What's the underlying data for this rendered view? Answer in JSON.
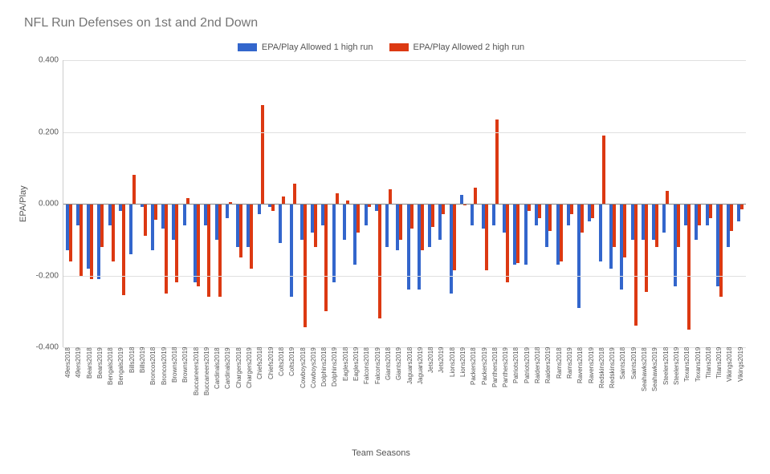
{
  "chart_data": {
    "type": "bar",
    "title": "NFL Run Defenses on 1st and 2nd Down",
    "xlabel": "Team Seasons",
    "ylabel": "EPA/Play",
    "ylim": [
      -0.4,
      0.4
    ],
    "yticks": [
      -0.4,
      -0.2,
      0.0,
      0.2,
      0.4
    ],
    "legend_position": "top-center",
    "categories": [
      "49ers2018",
      "49ers2019",
      "Bears2018",
      "Bears2019",
      "Bengals2018",
      "Bengals2019",
      "Bills2018",
      "Bills2019",
      "Broncos2018",
      "Broncos2019",
      "Browns2018",
      "Browns2019",
      "Buccaneers2018",
      "Buccaneers2019",
      "Cardinals2018",
      "Cardinals2019",
      "Chargers2018",
      "Chargers2019",
      "Chiefs2018",
      "Chiefs2019",
      "Colts2018",
      "Colts2019",
      "Cowboys2018",
      "Cowboys2019",
      "Dolphins2018",
      "Dolphins2019",
      "Eagles2018",
      "Eagles2019",
      "Falcons2018",
      "Falcons2019",
      "Giants2018",
      "Giants2019",
      "Jaguars2018",
      "Jaguars2019",
      "Jets2018",
      "Jets2019",
      "Lions2018",
      "Lions2019",
      "Packers2018",
      "Packers2019",
      "Panthers2018",
      "Panthers2019",
      "Patriots2018",
      "Patriots2019",
      "Raiders2018",
      "Raiders2019",
      "Rams2018",
      "Rams2019",
      "Ravens2018",
      "Ravens2019",
      "Redskins2018",
      "Redskins2019",
      "Saints2018",
      "Saints2019",
      "Seahawks2018",
      "Seahawks2019",
      "Steelers2018",
      "Steelers2019",
      "Texans2018",
      "Texans2019",
      "Titans2018",
      "Titans2019",
      "Vikings2018",
      "Vikings2019"
    ],
    "series": [
      {
        "name": "EPA/Play Allowed 1 high run",
        "color": "#3366cc",
        "values": [
          -0.13,
          -0.06,
          -0.18,
          -0.21,
          -0.06,
          -0.02,
          -0.14,
          -0.01,
          -0.13,
          -0.07,
          -0.1,
          -0.06,
          -0.22,
          -0.06,
          -0.1,
          -0.04,
          -0.12,
          -0.12,
          -0.03,
          -0.01,
          -0.11,
          -0.26,
          -0.1,
          -0.08,
          -0.06,
          -0.22,
          -0.1,
          -0.17,
          -0.06,
          -0.02,
          -0.12,
          -0.13,
          -0.24,
          -0.24,
          -0.12,
          -0.1,
          -0.25,
          0.025,
          -0.06,
          -0.07,
          -0.06,
          -0.08,
          -0.17,
          -0.17,
          -0.06,
          -0.12,
          -0.17,
          -0.06,
          -0.29,
          -0.05,
          -0.16,
          -0.18,
          -0.24,
          -0.1,
          -0.1,
          -0.1,
          -0.08,
          -0.23,
          -0.06,
          -0.1,
          -0.06,
          -0.23,
          -0.12,
          -0.05
        ]
      },
      {
        "name": "EPA/Play Allowed 2 high run",
        "color": "#dc3912",
        "values": [
          -0.16,
          -0.2,
          -0.21,
          -0.12,
          -0.16,
          -0.255,
          0.08,
          -0.09,
          -0.045,
          -0.25,
          -0.22,
          0.015,
          -0.23,
          -0.26,
          -0.26,
          0.005,
          -0.15,
          -0.18,
          0.275,
          -0.02,
          0.02,
          0.055,
          -0.345,
          -0.12,
          -0.3,
          0.03,
          0.01,
          -0.08,
          -0.01,
          -0.32,
          0.04,
          -0.1,
          -0.07,
          -0.13,
          -0.065,
          -0.03,
          -0.185,
          -0.005,
          0.045,
          -0.185,
          0.235,
          -0.22,
          -0.165,
          -0.02,
          -0.04,
          -0.075,
          -0.16,
          -0.03,
          -0.08,
          -0.04,
          0.19,
          -0.12,
          -0.15,
          -0.34,
          -0.245,
          -0.12,
          0.035,
          -0.12,
          -0.35,
          -0.06,
          -0.04,
          -0.26,
          -0.075,
          -0.015
        ]
      }
    ]
  },
  "colors": {
    "series1": "#3366cc",
    "series2": "#dc3912"
  }
}
